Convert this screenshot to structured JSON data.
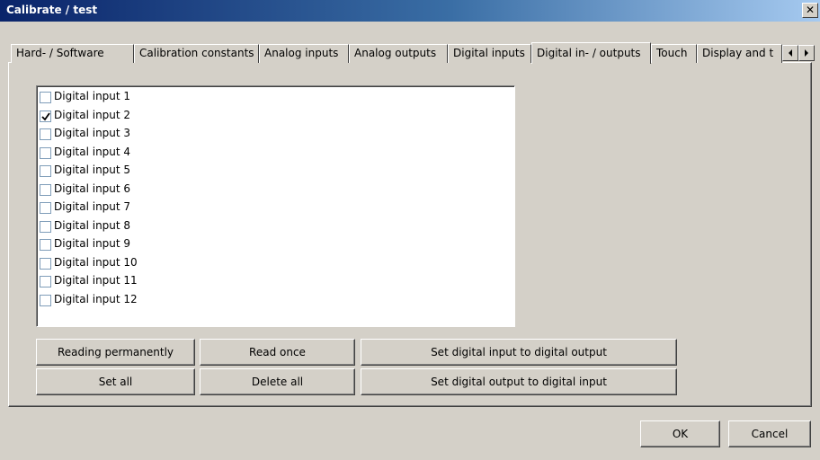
{
  "window": {
    "title": "Calibrate / test",
    "close_glyph": "✕"
  },
  "tabs": [
    {
      "label": "Hard- / Software"
    },
    {
      "label": "Calibration constants"
    },
    {
      "label": "Analog inputs"
    },
    {
      "label": "Analog outputs"
    },
    {
      "label": "Digital inputs"
    },
    {
      "label": "Digital in- / outputs",
      "active": true
    },
    {
      "label": "Touch"
    },
    {
      "label": "Display and t"
    }
  ],
  "tab_scroll": {
    "left_icon": "triangle-left-icon",
    "right_icon": "triangle-right-icon"
  },
  "inputs": [
    {
      "label": "Digital input 1",
      "checked": false
    },
    {
      "label": "Digital input 2",
      "checked": true
    },
    {
      "label": "Digital input 3",
      "checked": false
    },
    {
      "label": "Digital input 4",
      "checked": false
    },
    {
      "label": "Digital input 5",
      "checked": false
    },
    {
      "label": "Digital input 6",
      "checked": false
    },
    {
      "label": "Digital input 7",
      "checked": false
    },
    {
      "label": "Digital input 8",
      "checked": false
    },
    {
      "label": "Digital input 9",
      "checked": false
    },
    {
      "label": "Digital input 10",
      "checked": false
    },
    {
      "label": "Digital input 11",
      "checked": false
    },
    {
      "label": "Digital input 12",
      "checked": false
    }
  ],
  "buttons": {
    "reading_permanently": "Reading permanently",
    "read_once": "Read once",
    "set_in_to_out": "Set digital input to digital output",
    "set_all": "Set all",
    "delete_all": "Delete all",
    "set_out_to_in": "Set digital output to digital input",
    "ok": "OK",
    "cancel": "Cancel"
  }
}
